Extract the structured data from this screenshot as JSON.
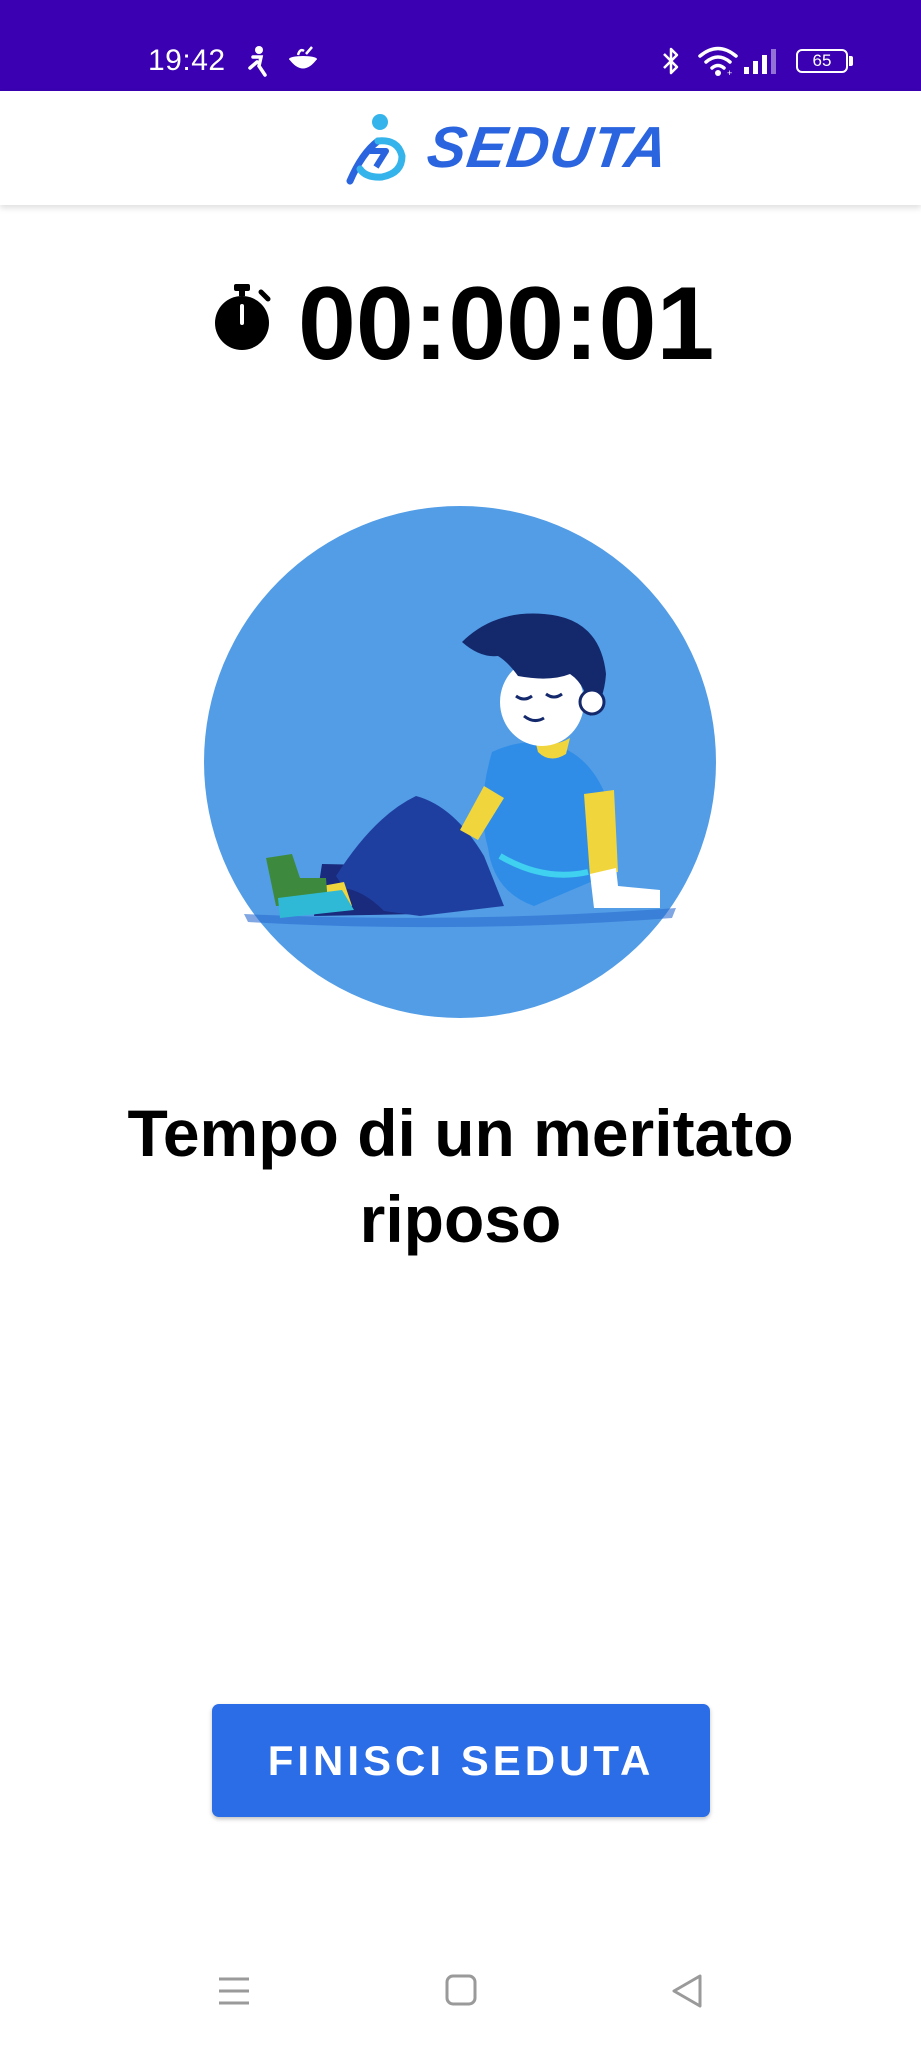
{
  "status_bar": {
    "time": "19:42",
    "battery": "65",
    "background": "#3a00b2"
  },
  "header": {
    "app_name": "SEDUTA",
    "brand_color": "#2a64df"
  },
  "timer": {
    "value": "00:00:01"
  },
  "message": "Tempo di un meritato riposo",
  "finish_button": {
    "label": "FINISCI SEDUTA",
    "color": "#2b6de6"
  },
  "icons": [
    "stopwatch-icon",
    "bluetooth-icon",
    "wifi-icon",
    "signal-icon",
    "battery-icon",
    "menu-icon",
    "home-icon",
    "back-icon"
  ]
}
